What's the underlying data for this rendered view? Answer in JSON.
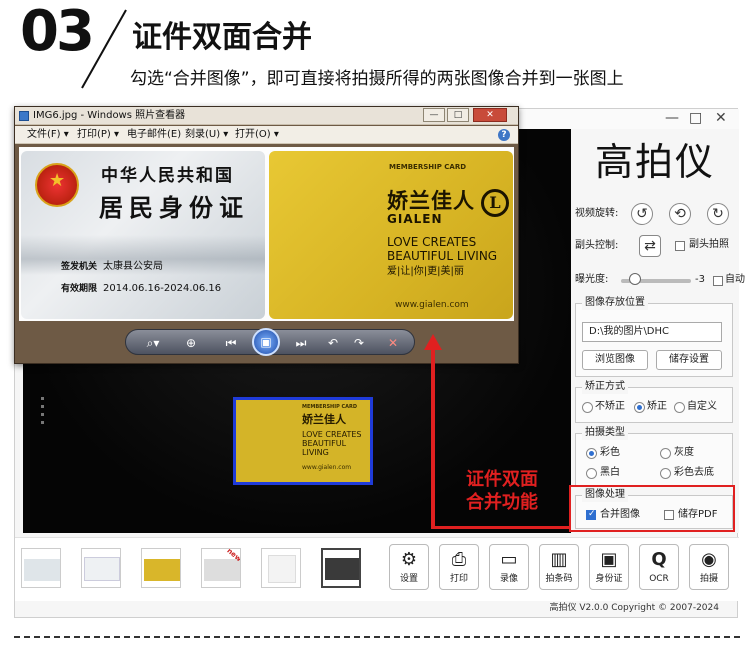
{
  "header": {
    "step_number": "03",
    "title": "证件双面合并",
    "subtitle": "勾选“合并图像”，即可直接将拍摄所得的两张图像合并到一张图上"
  },
  "viewer": {
    "title": "IMG6.jpg - Windows 照片查看器",
    "menu": [
      "文件(F) ▾",
      "打印(P) ▾",
      "电子邮件(E)",
      "刻录(U) ▾",
      "打开(O) ▾"
    ],
    "help": "?",
    "id_card": {
      "line1": "中华人民共和国",
      "line2": "居民身份证",
      "issuer_label": "签发机关",
      "issuer_value": "太康县公安局",
      "validity_label": "有效期限",
      "validity_value": "2014.06.16-2024.06.16"
    },
    "membership_card": {
      "header": "MEMBERSHIP CARD",
      "brand_cn": "娇兰佳人",
      "brand_en": "GIALEN",
      "logo": "L",
      "slogan1": "LOVE CREATES",
      "slogan2": "BEAUTIFUL LIVING",
      "slogan_cn": "爱|让|你|更|美|丽",
      "url": "www.gialen.com"
    },
    "controls": {
      "zoom": "⌕▾",
      "fit": "⊕",
      "prev": "⏮",
      "slideshow": "▣",
      "next": "⏭",
      "rotate_ccw": "↶",
      "rotate_cw": "↷",
      "delete": "✕"
    }
  },
  "app": {
    "window_controls": [
      "—",
      "□",
      "✕"
    ],
    "logo": "高拍仪",
    "video_rotate_label": "视频旋转:",
    "rotate_icons": [
      "↺",
      "⟲",
      "↻"
    ],
    "sub_camera_label": "副头控制:",
    "sub_camera_icon": "⇄",
    "sub_camera_capture": "副头拍照",
    "exposure_label": "曝光度:",
    "exposure_value": "-3",
    "auto_label": "自动",
    "storage": {
      "title": "图像存放位置",
      "path": "D:\\我的图片\\DHC",
      "browse_button": "浏览图像",
      "settings_button": "储存设置"
    },
    "correction": {
      "title": "矫正方式",
      "options": [
        "不矫正",
        "矫正",
        "自定义"
      ],
      "selected": "矫正"
    },
    "capture_type": {
      "title": "拍摄类型",
      "options": [
        "彩色",
        "灰度",
        "黑白",
        "彩色去底"
      ],
      "selected": "彩色"
    },
    "image_processing": {
      "title": "图像处理",
      "merge_label": "合并图像",
      "merge_checked": true,
      "pdf_label": "储存PDF",
      "pdf_checked": false
    },
    "preview_card": {
      "header": "MEMBERSHIP CARD",
      "brand": "娇兰佳人",
      "line1": "LOVE CREATES",
      "line2": "BEAUTIFUL LIVING",
      "url": "www.gialen.com"
    },
    "tools": [
      {
        "icon": "⚙",
        "label": "设置"
      },
      {
        "icon": "⎙",
        "label": "打印"
      },
      {
        "icon": "▭",
        "label": "录像"
      },
      {
        "icon": "▥",
        "label": "拍条码"
      },
      {
        "icon": "▣",
        "label": "身份证"
      },
      {
        "icon": "Q",
        "label": "OCR"
      },
      {
        "icon": "◉",
        "label": "拍摄"
      }
    ],
    "thumb_new_badge": "new",
    "copyright": "高拍仪 V2.0.0 Copyright © 2007-2024"
  },
  "annotation": {
    "line1": "证件双面",
    "line2": "合并功能",
    "color": "#e02020"
  }
}
